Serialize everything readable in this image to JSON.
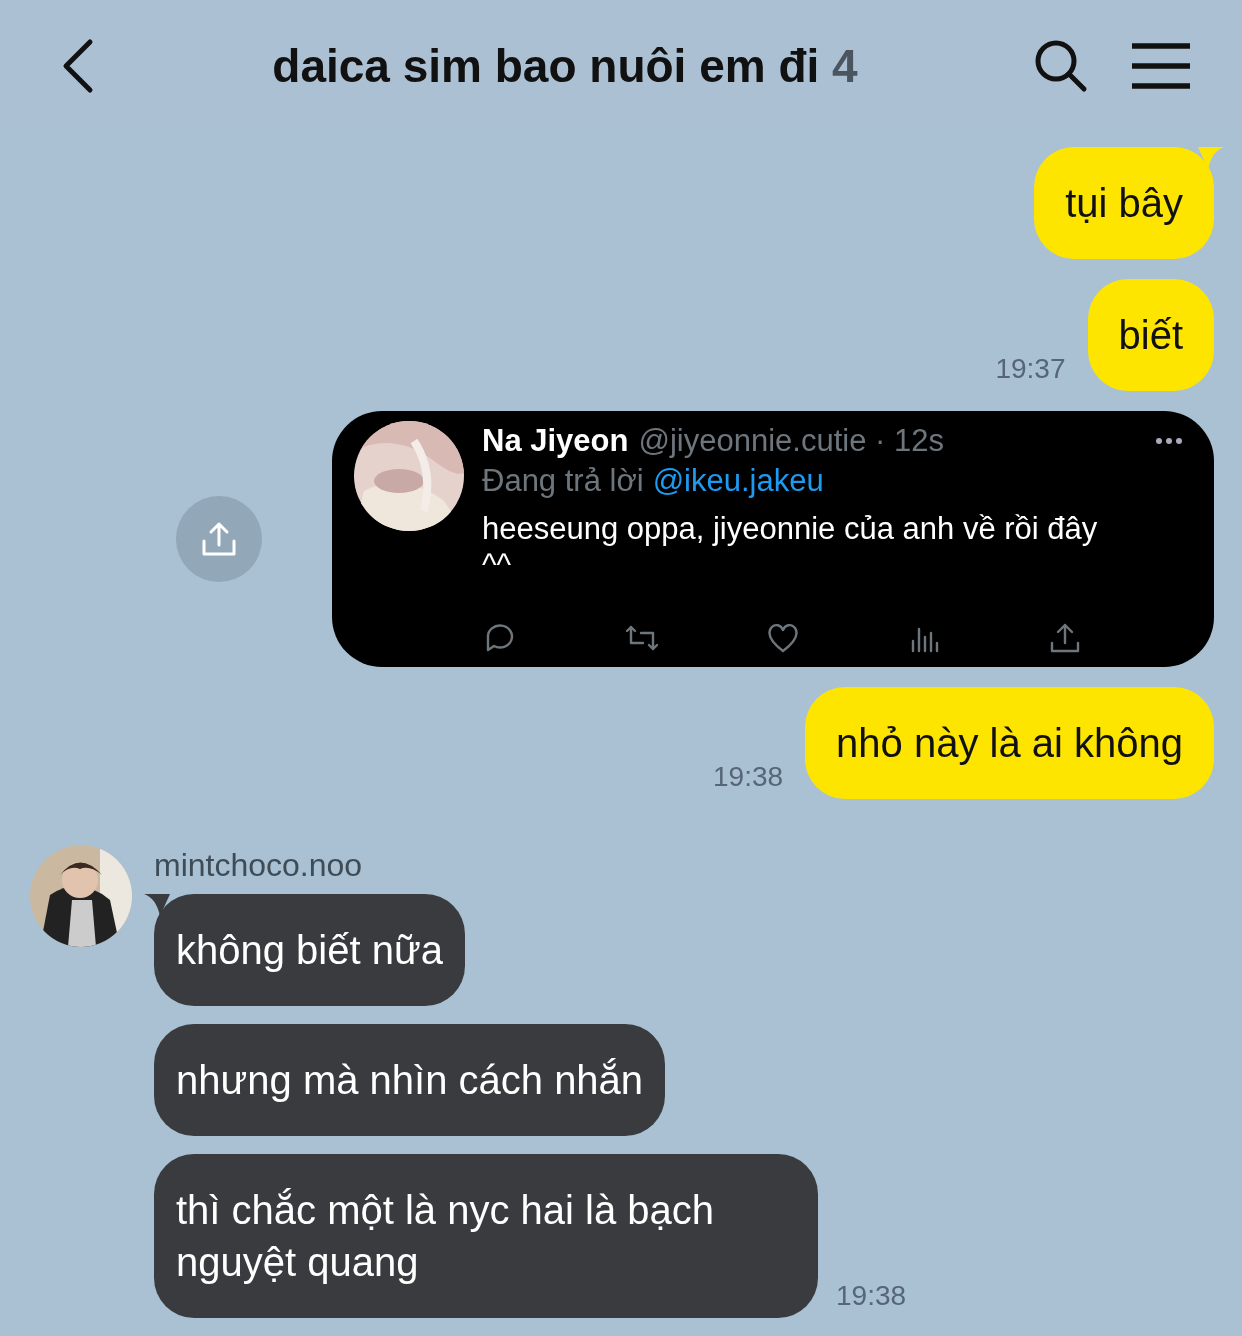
{
  "header": {
    "title": "daica sim bao nuôi em đi",
    "member_count": "4"
  },
  "outgoing": [
    {
      "kind": "text",
      "text": "tụi bây",
      "tail": true
    },
    {
      "kind": "text",
      "text": "biết",
      "tail": false,
      "time": "19:37"
    },
    {
      "kind": "tweet",
      "author": "Na Jiyeon",
      "handle": "@jiyeonnie.cutie · 12s",
      "reply_label": "Đang trả lời",
      "reply_to": "@ikeu.jakeu",
      "text": "heeseung oppa, jiyeonnie của anh về rồi đây ^^"
    },
    {
      "kind": "text",
      "text": "nhỏ này là ai không",
      "tail": false,
      "time": "19:38"
    }
  ],
  "incoming": {
    "sender": "mintchoco.noo",
    "messages": [
      {
        "kind": "text",
        "text": "không biết nữa",
        "tail": true
      },
      {
        "kind": "text",
        "text": "nhưng mà nhìn cách nhắn",
        "tail": false
      },
      {
        "kind": "text",
        "text": "thì chắc một là nyc hai là bạch nguyệt quang",
        "tail": false,
        "time": "19:38"
      }
    ]
  }
}
